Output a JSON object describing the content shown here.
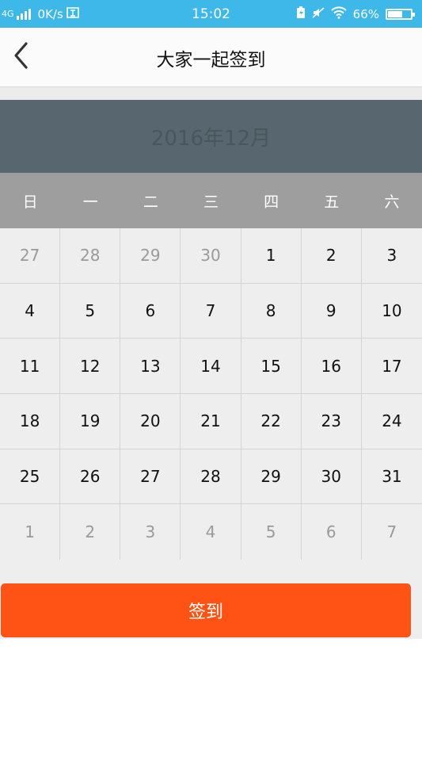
{
  "status_bar": {
    "network": "4G",
    "speed": "0K/s",
    "time": "15:02",
    "battery": "66%",
    "battery_level": 0.66,
    "icons": [
      "signal-icon",
      "sim-icon",
      "battery-charging-icon",
      "mute-icon",
      "wifi-icon",
      "battery-icon"
    ],
    "background": "#3db8e9"
  },
  "header": {
    "title": "大家一起签到",
    "back_icon": "chevron-left-icon"
  },
  "calendar": {
    "month_label": "2016年12月",
    "weekdays": [
      "日",
      "一",
      "二",
      "三",
      "四",
      "五",
      "六"
    ],
    "rows": [
      [
        {
          "day": "27",
          "muted": true
        },
        {
          "day": "28",
          "muted": true
        },
        {
          "day": "29",
          "muted": true
        },
        {
          "day": "30",
          "muted": true
        },
        {
          "day": "1",
          "muted": false
        },
        {
          "day": "2",
          "muted": false
        },
        {
          "day": "3",
          "muted": false
        }
      ],
      [
        {
          "day": "4",
          "muted": false
        },
        {
          "day": "5",
          "muted": false
        },
        {
          "day": "6",
          "muted": false
        },
        {
          "day": "7",
          "muted": false
        },
        {
          "day": "8",
          "muted": false
        },
        {
          "day": "9",
          "muted": false
        },
        {
          "day": "10",
          "muted": false
        }
      ],
      [
        {
          "day": "11",
          "muted": false
        },
        {
          "day": "12",
          "muted": false
        },
        {
          "day": "13",
          "muted": false
        },
        {
          "day": "14",
          "muted": false
        },
        {
          "day": "15",
          "muted": false
        },
        {
          "day": "16",
          "muted": false
        },
        {
          "day": "17",
          "muted": false
        }
      ],
      [
        {
          "day": "18",
          "muted": false
        },
        {
          "day": "19",
          "muted": false
        },
        {
          "day": "20",
          "muted": false
        },
        {
          "day": "21",
          "muted": false
        },
        {
          "day": "22",
          "muted": false
        },
        {
          "day": "23",
          "muted": false
        },
        {
          "day": "24",
          "muted": false
        }
      ],
      [
        {
          "day": "25",
          "muted": false
        },
        {
          "day": "26",
          "muted": false
        },
        {
          "day": "27",
          "muted": false
        },
        {
          "day": "28",
          "muted": false
        },
        {
          "day": "29",
          "muted": false
        },
        {
          "day": "30",
          "muted": false
        },
        {
          "day": "31",
          "muted": false
        }
      ],
      [
        {
          "day": "1",
          "muted": true
        },
        {
          "day": "2",
          "muted": true
        },
        {
          "day": "3",
          "muted": true
        },
        {
          "day": "4",
          "muted": true
        },
        {
          "day": "5",
          "muted": true
        },
        {
          "day": "6",
          "muted": true
        },
        {
          "day": "7",
          "muted": true
        }
      ]
    ],
    "colors": {
      "month_bg": "#58676f",
      "weekday_bg": "#9e9e9e",
      "grid_bg": "#eeeeee",
      "muted_text": "#9a9a9a"
    }
  },
  "actions": {
    "sign_label": "签到",
    "sign_color": "#ff5316"
  }
}
